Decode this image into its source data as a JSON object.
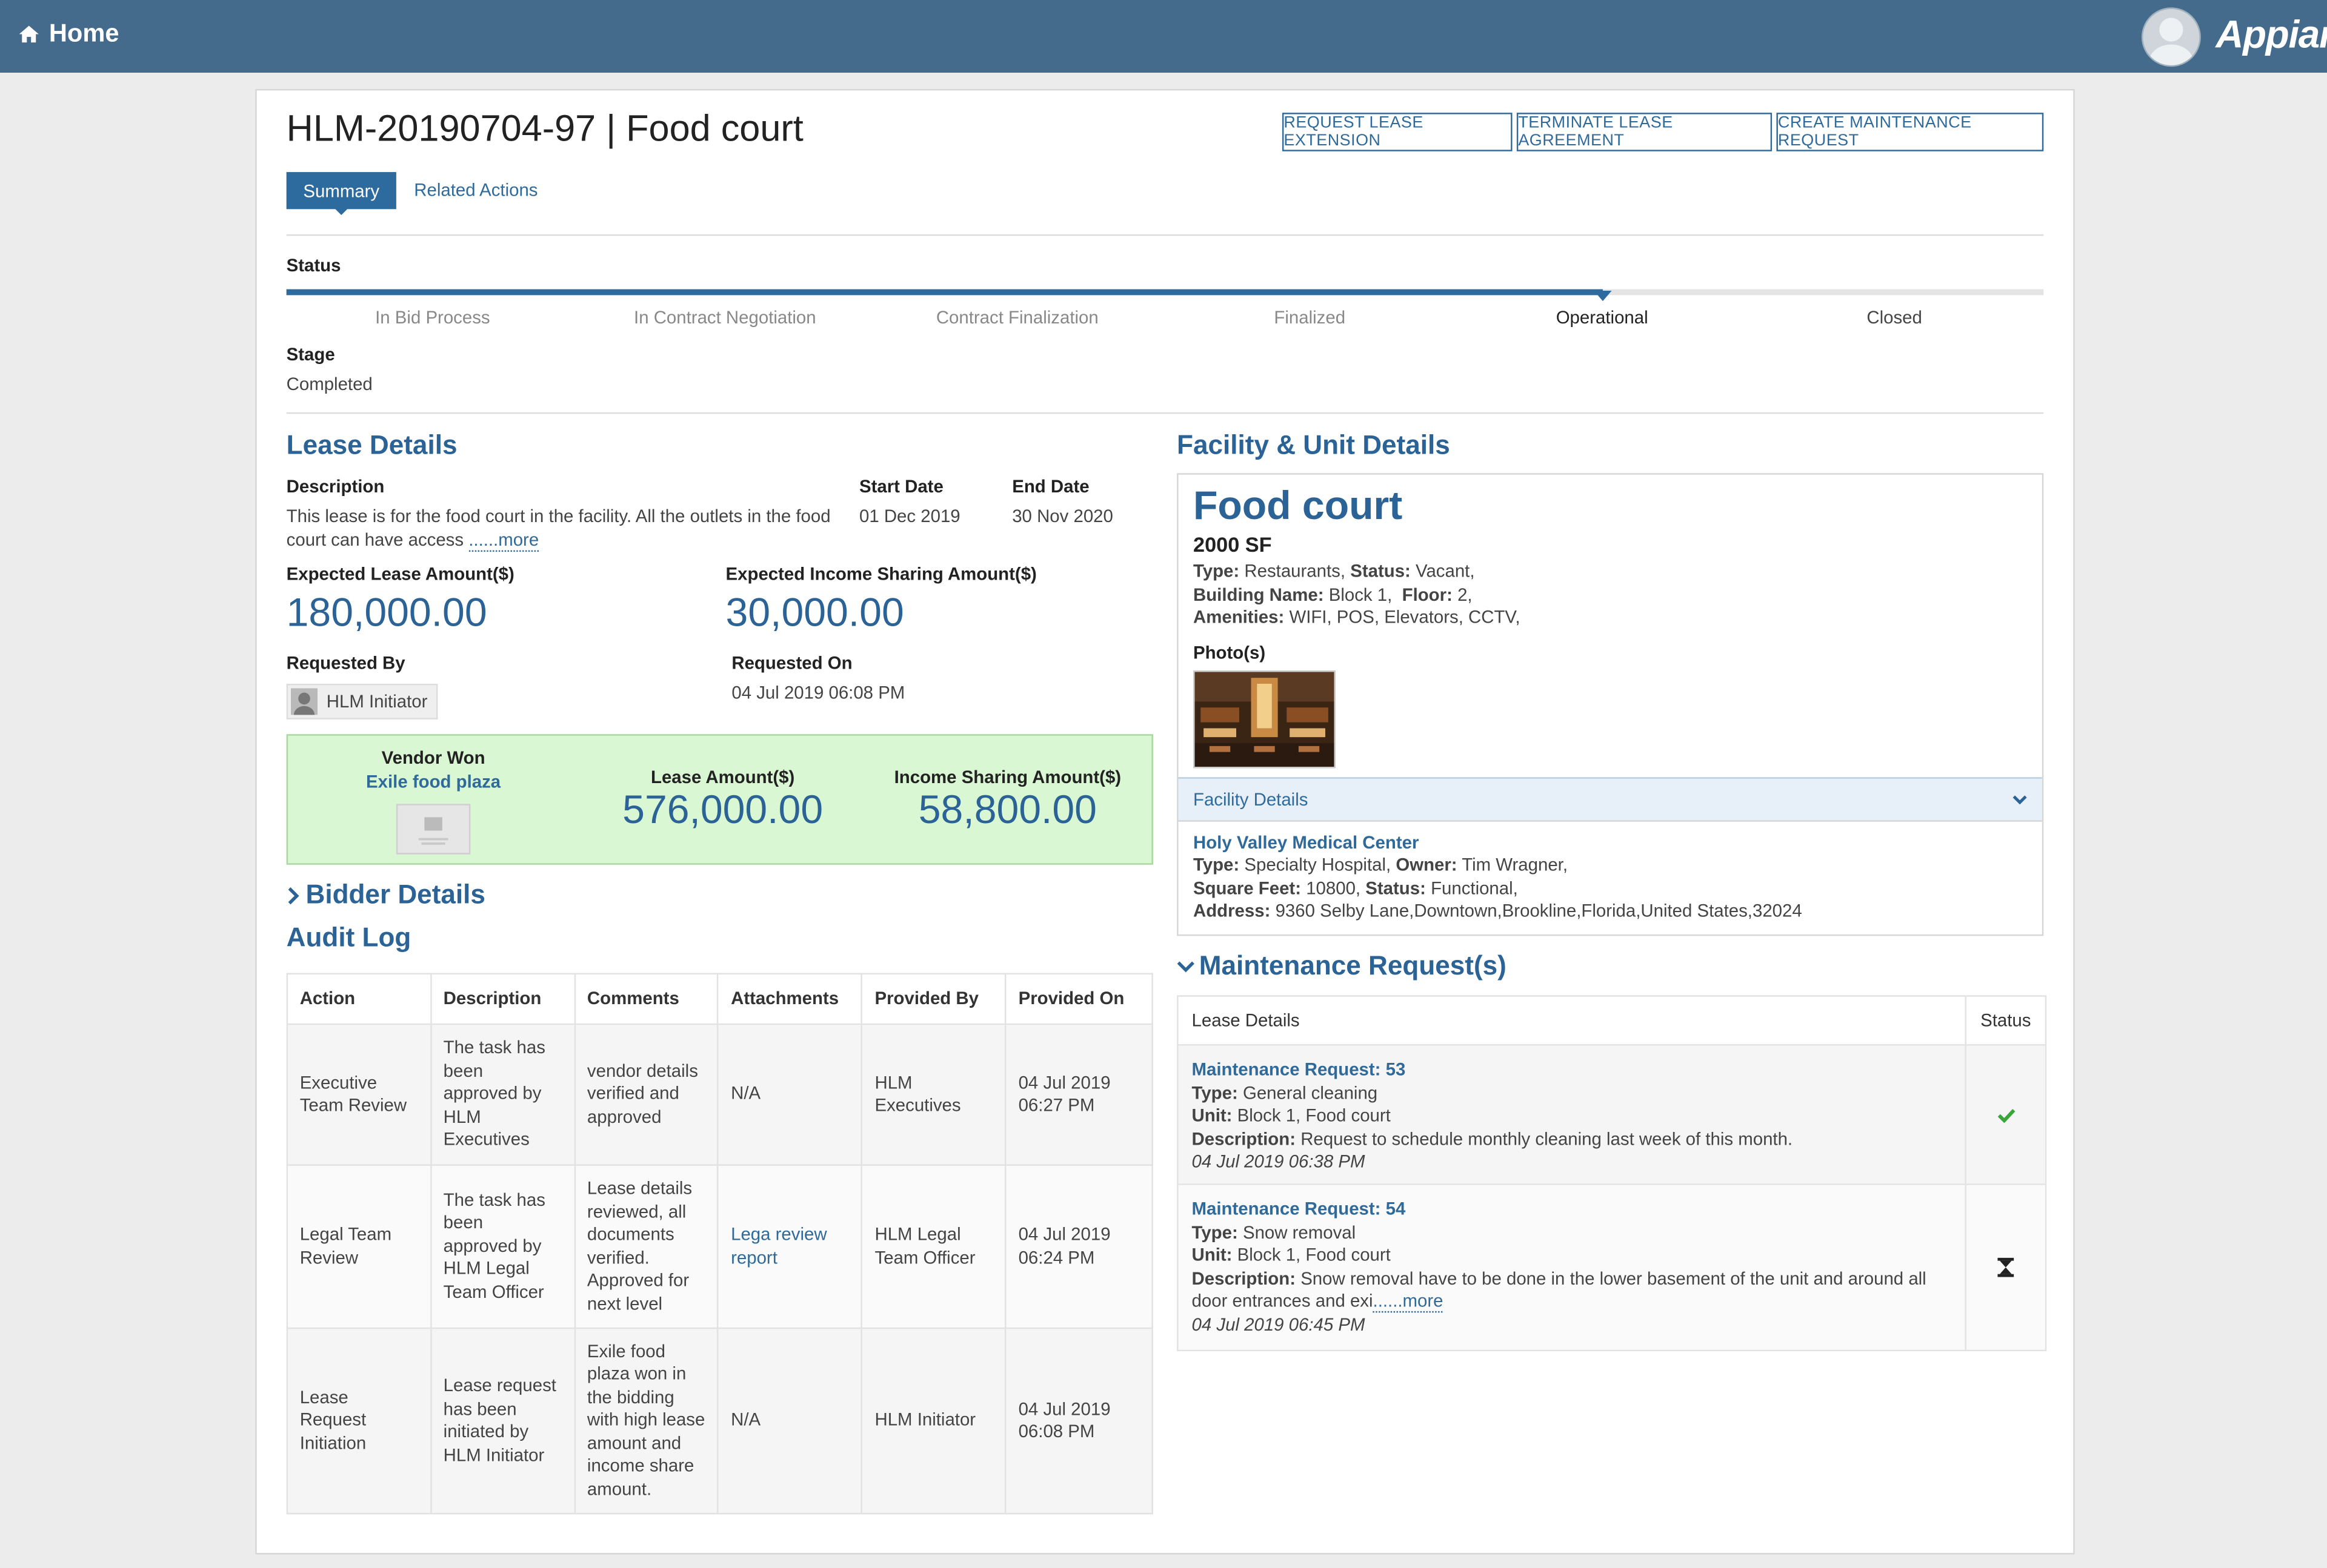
{
  "header": {
    "home_label": "Home",
    "brand": "Appian"
  },
  "record": {
    "title": "HLM-20190704-97 | Food court"
  },
  "actions": [
    "REQUEST LEASE EXTENSION",
    "TERMINATE LEASE AGREEMENT",
    "CREATE MAINTENANCE REQUEST"
  ],
  "tabs": {
    "summary": "Summary",
    "related": "Related Actions"
  },
  "status": {
    "label": "Status",
    "stages": [
      "In Bid Process",
      "In Contract Negotiation",
      "Contract Finalization",
      "Finalized",
      "Operational",
      "Closed"
    ],
    "current_index": 4,
    "stage_label": "Stage",
    "stage_value": "Completed"
  },
  "lease": {
    "heading": "Lease Details",
    "desc_label": "Description",
    "desc_text": "This lease is for the food court in the facility. All the outlets in the food court can have access ",
    "desc_more": "......more",
    "start_label": "Start Date",
    "start_value": "01 Dec 2019",
    "end_label": "End Date",
    "end_value": "30 Nov 2020",
    "exp_lease_label": "Expected Lease Amount($)",
    "exp_lease_value": "180,000.00",
    "exp_income_label": "Expected Income Sharing Amount($)",
    "exp_income_value": "30,000.00",
    "req_by_label": "Requested By",
    "req_by_value": "HLM Initiator",
    "req_on_label": "Requested On",
    "req_on_value": "04 Jul 2019 06:08 PM"
  },
  "vendor": {
    "won_label": "Vendor Won",
    "name": "Exile food plaza",
    "lease_amount_label": "Lease Amount($)",
    "lease_amount": "576,000.00",
    "income_label": "Income Sharing Amount($)",
    "income_amount": "58,800.00"
  },
  "bidder": {
    "heading": "Bidder Details"
  },
  "audit": {
    "heading": "Audit Log",
    "columns": [
      "Action",
      "Description",
      "Comments",
      "Attachments",
      "Provided By",
      "Provided On"
    ],
    "rows": [
      {
        "action": "Executive Team Review",
        "description": "The task has been approved by HLM Executives",
        "comments": "vendor details verified and approved",
        "attachment": "N/A",
        "provided_by": "HLM Executives",
        "provided_on": "04 Jul 2019 06:27 PM"
      },
      {
        "action": "Legal Team Review",
        "description": "The task has been approved by HLM Legal Team Officer",
        "comments": "Lease details reviewed, all documents verified. Approved for next level",
        "attachment": "Lega review report",
        "provided_by": "HLM Legal Team Officer",
        "provided_on": "04 Jul 2019 06:24 PM"
      },
      {
        "action": "Lease Request Initiation",
        "description": "Lease request has been initiated by HLM Initiator",
        "comments": "Exile food plaza won in the bidding with high lease amount and income share amount.",
        "attachment": "N/A",
        "provided_by": "HLM Initiator",
        "provided_on": "04 Jul 2019 06:08 PM"
      }
    ]
  },
  "facility": {
    "heading": "Facility & Unit Details",
    "unit_name": "Food court",
    "size": "2000 SF",
    "type_label": "Type:",
    "type_value": "Restaurants,",
    "status_label": "Status:",
    "status_value": "Vacant,",
    "building_label": "Building Name:",
    "building_value": "Block 1,",
    "floor_label": "Floor:",
    "floor_value": "2,",
    "amenities_label": "Amenities:",
    "amenities_value": "WIFI, POS, Elevators, CCTV,",
    "photos_label": "Photo(s)",
    "details_section": "Facility Details",
    "facility_name": "Holy Valley Medical Center",
    "f_type_value": "Specialty Hospital,",
    "owner_label": "Owner:",
    "owner_value": "Tim Wragner,",
    "sqft_label": "Square Feet:",
    "sqft_value": "10800,",
    "f_status_value": "Functional,",
    "address_label": "Address:",
    "address_value": "9360 Selby Lane,Downtown,Brookline,Florida,United States,32024"
  },
  "maintenance": {
    "heading": "Maintenance Request(s)",
    "col_details": "Lease Details",
    "col_status": "Status",
    "type_label": "Type:",
    "unit_label": "Unit:",
    "desc_label": "Description:",
    "requests": [
      {
        "title": "Maintenance Request: 53",
        "type": "General cleaning",
        "unit": "Block 1, Food court",
        "description": "Request to schedule monthly cleaning last week of this month.",
        "date": "04 Jul 2019 06:38 PM",
        "status_icon": "check-icon"
      },
      {
        "title": "Maintenance Request: 54",
        "type": "Snow removal",
        "unit": "Block 1, Food court",
        "description": "Snow removal have to be done in the lower basement of the unit and around all door entrances and exi",
        "more": "......more",
        "date": "04 Jul 2019 06:45 PM",
        "status_icon": "hourglass-icon"
      }
    ]
  }
}
